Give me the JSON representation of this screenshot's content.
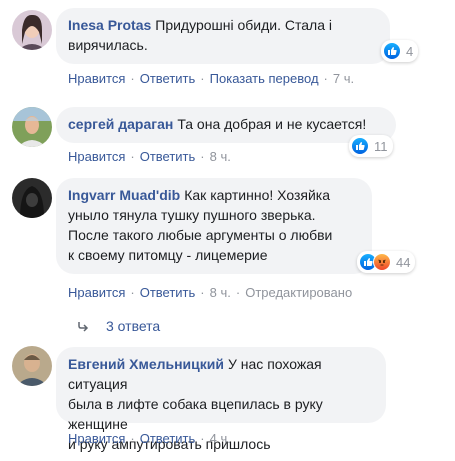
{
  "labels": {
    "like": "Нравится",
    "reply": "Ответить",
    "translate": "Показать перевод",
    "edited": "Отредактировано",
    "separator": "·"
  },
  "comments": [
    {
      "author": "Inesa Protas",
      "text_lines": [
        "Придурошні обиди. Стала і",
        "вирячилась."
      ],
      "reactions": {
        "icons": [
          "like-icon"
        ],
        "count": "4"
      },
      "time": "7 ч."
    },
    {
      "author": "сергей дараган",
      "text_lines": [
        "Та она добрая и не кусается!"
      ],
      "reactions": {
        "icons": [
          "like-icon"
        ],
        "count": "11"
      },
      "time": "8 ч."
    },
    {
      "author": "Ingvarr Muad'dib",
      "text_lines": [
        "Как картинно! Хозяйка",
        "уныло тянула тушку пушного зверька.",
        "После такого любые аргументы о любви",
        "к своему питомцу - лицемерие"
      ],
      "reactions": {
        "icons": [
          "like-icon",
          "angry-icon"
        ],
        "count": "44"
      },
      "time": "8 ч.",
      "replies": "3 ответа"
    },
    {
      "author": "Евгений Хмельницкий",
      "text_lines": [
        "У нас похожая ситуация",
        "была в лифте собака вцепилась в руку женщине",
        "и руку ампутировать пришлось"
      ],
      "time": "4 ч."
    }
  ],
  "colors": {
    "author": "#385898",
    "bubble": "#f2f3f5",
    "text": "#1c1e21",
    "meta": "#90949c"
  }
}
